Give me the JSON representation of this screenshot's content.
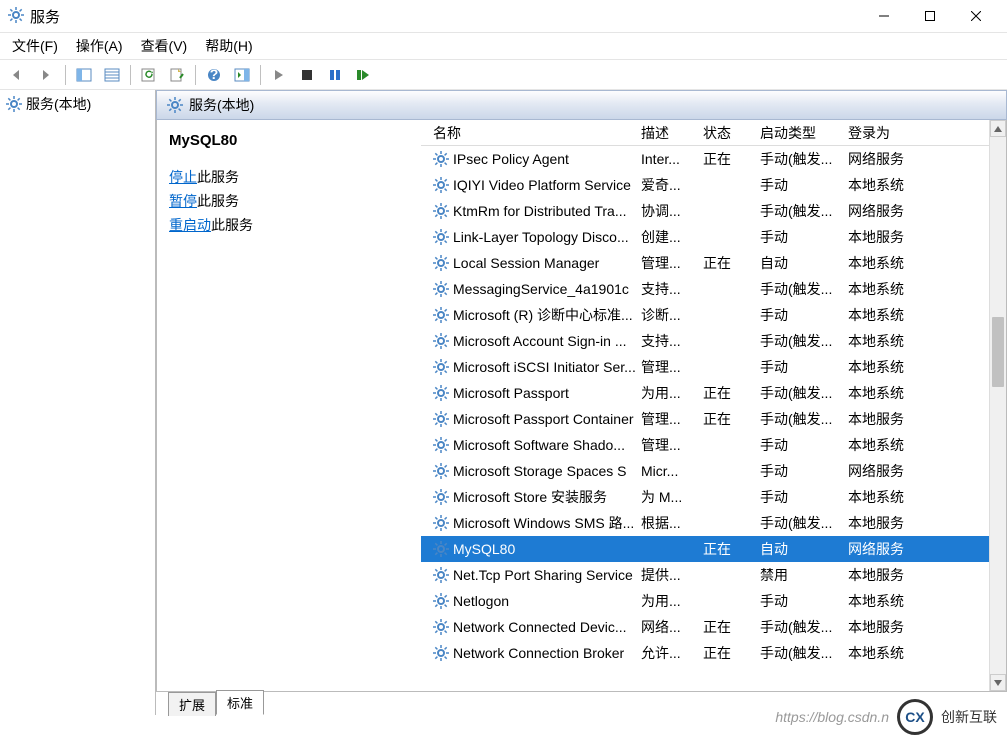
{
  "window": {
    "title": "服务"
  },
  "menubar": [
    "文件(F)",
    "操作(A)",
    "查看(V)",
    "帮助(H)"
  ],
  "nav": {
    "root": "服务(本地)"
  },
  "contentHeader": "服务(本地)",
  "detail": {
    "selected": "MySQL80",
    "stop_label": "停止",
    "pause_label": "暂停",
    "restart_label": "重启动",
    "suffix": "此服务"
  },
  "columns": {
    "name": "名称",
    "desc": "描述",
    "status": "状态",
    "startup": "启动类型",
    "logon": "登录为"
  },
  "rows": [
    {
      "name": "IPsec Policy Agent",
      "desc": "Inter...",
      "status": "正在",
      "startup": "手动(触发...",
      "logon": "网络服务"
    },
    {
      "name": "IQIYI Video Platform Service",
      "desc": "爱奇...",
      "status": "",
      "startup": "手动",
      "logon": "本地系统"
    },
    {
      "name": "KtmRm for Distributed Tra...",
      "desc": "协调...",
      "status": "",
      "startup": "手动(触发...",
      "logon": "网络服务"
    },
    {
      "name": "Link-Layer Topology Disco...",
      "desc": "创建...",
      "status": "",
      "startup": "手动",
      "logon": "本地服务"
    },
    {
      "name": "Local Session Manager",
      "desc": "管理...",
      "status": "正在",
      "startup": "自动",
      "logon": "本地系统"
    },
    {
      "name": "MessagingService_4a1901c",
      "desc": "支持...",
      "status": "",
      "startup": "手动(触发...",
      "logon": "本地系统"
    },
    {
      "name": "Microsoft (R) 诊断中心标准...",
      "desc": "诊断...",
      "status": "",
      "startup": "手动",
      "logon": "本地系统"
    },
    {
      "name": "Microsoft Account Sign-in ...",
      "desc": "支持...",
      "status": "",
      "startup": "手动(触发...",
      "logon": "本地系统"
    },
    {
      "name": "Microsoft iSCSI Initiator Ser...",
      "desc": "管理...",
      "status": "",
      "startup": "手动",
      "logon": "本地系统"
    },
    {
      "name": "Microsoft Passport",
      "desc": "为用...",
      "status": "正在",
      "startup": "手动(触发...",
      "logon": "本地系统"
    },
    {
      "name": "Microsoft Passport Container",
      "desc": "管理...",
      "status": "正在",
      "startup": "手动(触发...",
      "logon": "本地服务"
    },
    {
      "name": "Microsoft Software Shado...",
      "desc": "管理...",
      "status": "",
      "startup": "手动",
      "logon": "本地系统"
    },
    {
      "name": "Microsoft Storage Spaces S",
      "desc": "Micr...",
      "status": "",
      "startup": "手动",
      "logon": "网络服务"
    },
    {
      "name": "Microsoft Store 安装服务",
      "desc": "为 M...",
      "status": "",
      "startup": "手动",
      "logon": "本地系统"
    },
    {
      "name": "Microsoft Windows SMS 路...",
      "desc": "根据...",
      "status": "",
      "startup": "手动(触发...",
      "logon": "本地服务"
    },
    {
      "name": "MySQL80",
      "desc": "",
      "status": "正在",
      "startup": "自动",
      "logon": "网络服务",
      "selected": true
    },
    {
      "name": "Net.Tcp Port Sharing Service",
      "desc": "提供...",
      "status": "",
      "startup": "禁用",
      "logon": "本地服务"
    },
    {
      "name": "Netlogon",
      "desc": "为用...",
      "status": "",
      "startup": "手动",
      "logon": "本地系统"
    },
    {
      "name": "Network Connected Devic...",
      "desc": "网络...",
      "status": "正在",
      "startup": "手动(触发...",
      "logon": "本地服务"
    },
    {
      "name": "Network Connection Broker",
      "desc": "允许...",
      "status": "正在",
      "startup": "手动(触发...",
      "logon": "本地系统"
    }
  ],
  "tabs": {
    "extended": "扩展",
    "standard": "标准"
  },
  "watermark": {
    "url": "https://blog.csdn.n",
    "brand": "创新互联"
  }
}
